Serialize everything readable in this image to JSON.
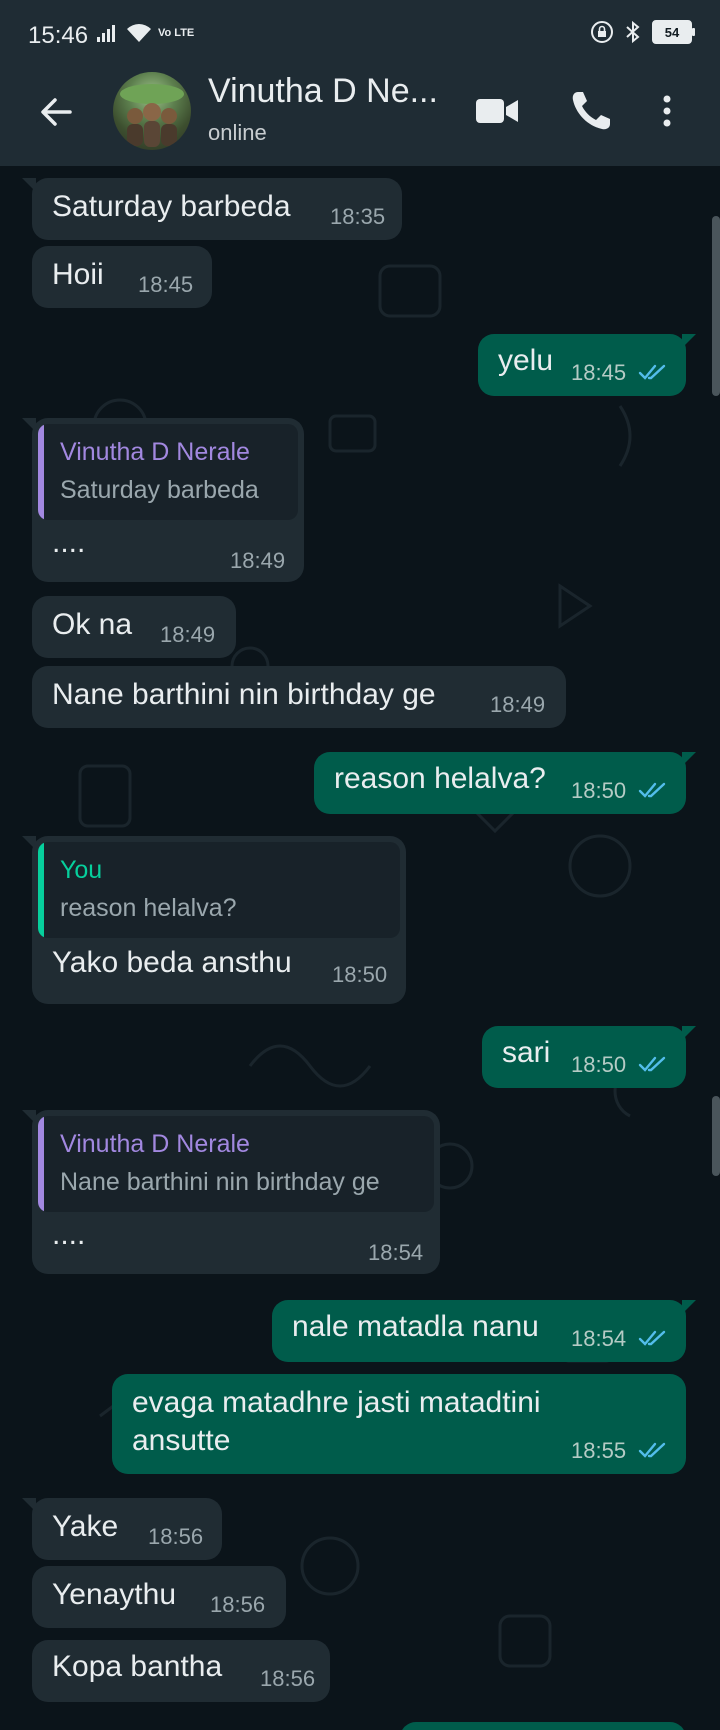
{
  "status_bar": {
    "time": "15:46",
    "network_label": "Vo LTE",
    "battery": "54",
    "icons": [
      "signal-icon",
      "wifi-icon",
      "volte-icon",
      "lock-icon",
      "bluetooth-icon",
      "battery-icon"
    ]
  },
  "header": {
    "name": "Vinutha D Ne...",
    "status": "online",
    "icons": [
      "back-arrow-icon",
      "video-call-icon",
      "voice-call-icon",
      "more-options-icon"
    ]
  },
  "colors": {
    "background": "#0b141a",
    "incoming": "#202c33",
    "outgoing": "#005c4b",
    "read_ticks": "#53bdeb",
    "quote_contact": "#a288e0",
    "quote_you": "#06cf9c"
  },
  "messages": [
    {
      "dir": "in",
      "text": "Saturday barbeda",
      "time": "18:35"
    },
    {
      "dir": "in",
      "text": "Hoii",
      "time": "18:45"
    },
    {
      "dir": "out",
      "text": "yelu",
      "time": "18:45",
      "status": "read"
    },
    {
      "dir": "in",
      "quote_name": "Vinutha D Nerale",
      "quote_text": "Saturday barbeda",
      "text": "....",
      "time": "18:49"
    },
    {
      "dir": "in",
      "text": "Ok na",
      "time": "18:49"
    },
    {
      "dir": "in",
      "text": "Nane barthini nin birthday ge",
      "time": "18:49"
    },
    {
      "dir": "out",
      "text": "reason helalva?",
      "time": "18:50",
      "status": "read"
    },
    {
      "dir": "in",
      "quote_name": "You",
      "quote_text": "reason helalva?",
      "text": "Yako beda ansthu",
      "time": "18:50"
    },
    {
      "dir": "out",
      "text": "sari",
      "time": "18:50",
      "status": "read"
    },
    {
      "dir": "in",
      "quote_name": "Vinutha D Nerale",
      "quote_text": "Nane barthini nin birthday ge",
      "text": "....",
      "time": "18:54"
    },
    {
      "dir": "out",
      "text": "nale matadla nanu",
      "time": "18:54",
      "status": "read"
    },
    {
      "dir": "out",
      "text_line1": "evaga matadhre jasti matadtini",
      "text_line2": "ansutte",
      "time": "18:55",
      "status": "read"
    },
    {
      "dir": "in",
      "text": "Yake",
      "time": "18:56"
    },
    {
      "dir": "in",
      "text": "Yenaythu",
      "time": "18:56"
    },
    {
      "dir": "in",
      "text": "Kopa bantha",
      "time": "18:56"
    }
  ]
}
